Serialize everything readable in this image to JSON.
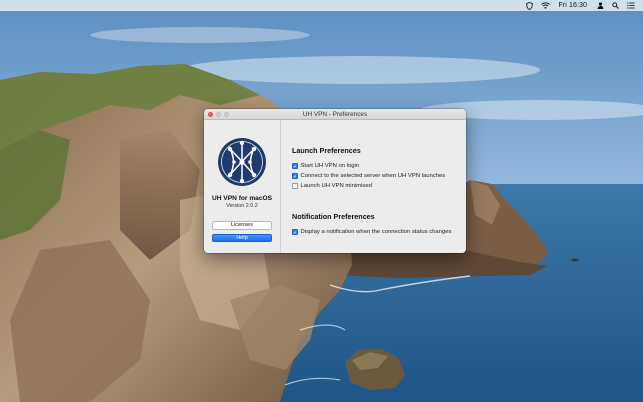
{
  "menubar": {
    "items": [
      {
        "name": "vpn-shield-icon",
        "type": "icon"
      },
      {
        "name": "wifi-icon",
        "type": "icon"
      },
      {
        "name": "clock",
        "type": "text"
      },
      {
        "name": "user-icon",
        "type": "icon"
      },
      {
        "name": "spotlight-search-icon",
        "type": "icon"
      },
      {
        "name": "notification-center-icon",
        "type": "icon"
      }
    ],
    "clock": "Fri 16:30"
  },
  "window": {
    "title": "UH VPN - Preferences",
    "traffic_lights": [
      "close",
      "minimize",
      "maximize"
    ]
  },
  "app": {
    "logo_icon": "network-nodes-icon",
    "name": "UH VPN for macOS",
    "version": "Version 2.0.2",
    "licenses_label": "Licenses",
    "help_label": "Help"
  },
  "launch": {
    "title": "Launch Preferences",
    "options": [
      {
        "label": "Start UH VPN on login",
        "checked": true
      },
      {
        "label": "Connect to the selected server when UH VPN launches",
        "checked": true
      },
      {
        "label": "Launch UH VPN minimised",
        "checked": false
      }
    ]
  },
  "notification": {
    "title": "Notification Preferences",
    "options": [
      {
        "label": "Display a notification when the connection status changes",
        "checked": true
      }
    ]
  },
  "colors": {
    "accent": "#2f7cf6",
    "close_light": "#fc605b",
    "logo_dark": "#1f3a6e"
  }
}
